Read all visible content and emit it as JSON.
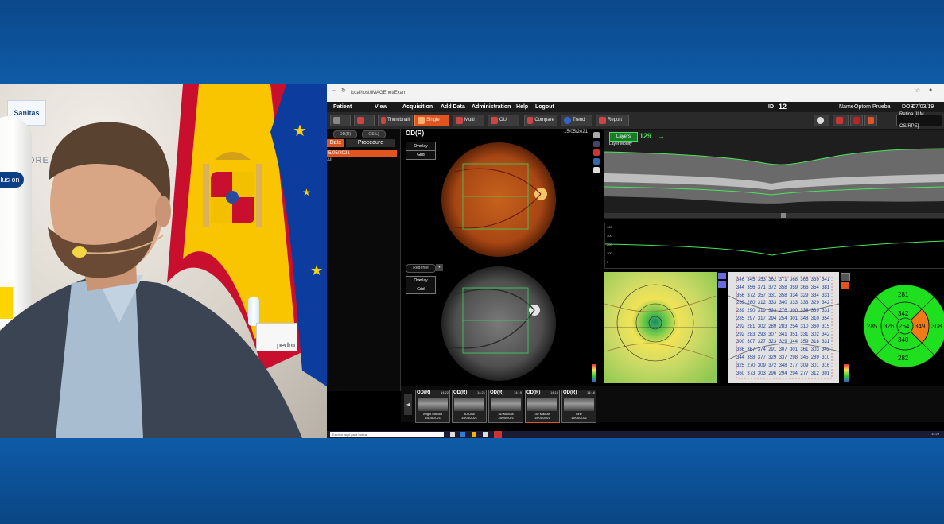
{
  "camera": {
    "logo_text": "Sanitas",
    "wall_text": "DORE",
    "machine_label": "plus on",
    "nameplate": "pedro"
  },
  "browser": {
    "url": "localhost/IMAGEnet/Exam"
  },
  "menu": {
    "items": [
      "Patient",
      "View",
      "Acquisition",
      "Add Data",
      "Administration",
      "Help",
      "Logout"
    ],
    "id_label": "ID",
    "id_value": "12",
    "name_label": "Name",
    "name_value": "Optom Prueba",
    "dob_label": "DOB",
    "dob_value": "07/03/19"
  },
  "toolbar": {
    "buttons": [
      "Thumbnail",
      "Single",
      "Multi",
      "OU",
      "Compare",
      "Trend",
      "Report"
    ],
    "active": "Single",
    "layer_select": "Retina [ILM OS/RPE]"
  },
  "left_pane": {
    "pills": [
      "OD(R)",
      "OS(L)"
    ],
    "tabs": [
      "Date",
      "Procedure"
    ],
    "date_entry": "5/05/2021",
    "all_label": "All"
  },
  "fundus": {
    "eye_label": "OD(R)",
    "date": "15/05/2021",
    "overlay_label": "Overlay",
    "grid_label": "Grid",
    "redfree_select": "Red-free"
  },
  "oct": {
    "layers_button": "Layers",
    "layer_value": "129",
    "layer_modify": "Layer Modify",
    "profile_ticks": [
      "400",
      "300",
      "200",
      "100",
      "0"
    ]
  },
  "thickness_grid": [
    [
      "346",
      "345",
      "353",
      "362",
      "371",
      "368",
      "365",
      "339",
      "341"
    ],
    [
      "344",
      "356",
      "371",
      "372",
      "358",
      "359",
      "366",
      "354",
      "381"
    ],
    [
      "356",
      "372",
      "357",
      "331",
      "358",
      "334",
      "329",
      "334",
      "331"
    ],
    [
      "269",
      "280",
      "312",
      "333",
      "340",
      "333",
      "333",
      "329",
      "342"
    ],
    [
      "289",
      "290",
      "319",
      "323",
      "276",
      "300",
      "338",
      "339",
      "331"
    ],
    [
      "285",
      "297",
      "317",
      "294",
      "254",
      "301",
      "348",
      "310",
      "354"
    ],
    [
      "292",
      "281",
      "302",
      "289",
      "283",
      "254",
      "310",
      "360",
      "315"
    ],
    [
      "292",
      "283",
      "293",
      "307",
      "341",
      "351",
      "331",
      "302",
      "342"
    ],
    [
      "300",
      "307",
      "327",
      "323",
      "329",
      "344",
      "359",
      "318",
      "331"
    ],
    [
      "336",
      "367",
      "374",
      "291",
      "307",
      "301",
      "361",
      "303",
      "342"
    ],
    [
      "344",
      "358",
      "377",
      "329",
      "337",
      "298",
      "345",
      "289",
      "310"
    ],
    [
      "325",
      "270",
      "309",
      "372",
      "348",
      "277",
      "309",
      "301",
      "316"
    ],
    [
      "360",
      "373",
      "303",
      "296",
      "294",
      "294",
      "277",
      "312",
      "301"
    ]
  ],
  "etdrs": {
    "center": "264",
    "inner": {
      "top": "342",
      "left": "326",
      "right": "349",
      "bottom": "340"
    },
    "outer": {
      "top": "281",
      "left": "285",
      "right": "308",
      "bottom": "282"
    }
  },
  "thumbnails": [
    {
      "eye": "OD(R)",
      "time": "14:22",
      "label": "Angio Maculit",
      "date": "15/05/2021"
    },
    {
      "eye": "OD(R)",
      "time": "14:21",
      "label": "3D Disc",
      "date": "15/05/2021"
    },
    {
      "eye": "OD(R)",
      "time": "14:19",
      "label": "3D Macula",
      "date": "15/05/2021"
    },
    {
      "eye": "OD(R)",
      "time": "14:18",
      "label": "3D Macula",
      "date": "15/05/2021"
    },
    {
      "eye": "OD(R)",
      "time": "14:16",
      "label": "Line",
      "date": "15/05/2021"
    }
  ],
  "taskbar": {
    "search_placeholder": "Escribe aquí para buscar",
    "clock": "14:29"
  }
}
